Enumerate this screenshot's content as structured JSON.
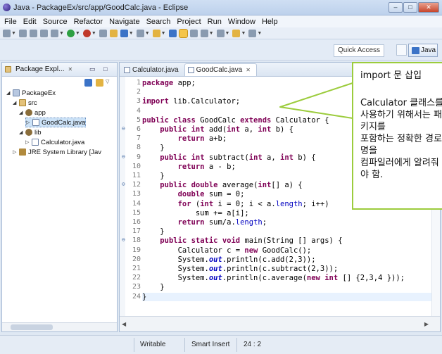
{
  "window": {
    "title": "Java - PackageEx/src/app/GoodCalc.java - Eclipse",
    "minimize_label": "–",
    "maximize_label": "□",
    "close_label": "✕"
  },
  "menu": [
    "File",
    "Edit",
    "Source",
    "Refactor",
    "Navigate",
    "Search",
    "Project",
    "Run",
    "Window",
    "Help"
  ],
  "quick_access": {
    "placeholder": "Quick Access"
  },
  "perspective": {
    "label": "Java"
  },
  "package_explorer": {
    "tab_label": "Package Expl...",
    "tree": [
      {
        "label": "PackageEx",
        "level": 0,
        "icon": "project-icon",
        "twisty": "◢"
      },
      {
        "label": "src",
        "level": 1,
        "icon": "source-folder-icon",
        "twisty": "◢"
      },
      {
        "label": "app",
        "level": 2,
        "icon": "package-icon",
        "twisty": "◢"
      },
      {
        "label": "GoodCalc.java",
        "level": 3,
        "icon": "java-file-icon",
        "twisty": "▷",
        "selected": true
      },
      {
        "label": "lib",
        "level": 2,
        "icon": "package-icon",
        "twisty": "◢"
      },
      {
        "label": "Calculator.java",
        "level": 3,
        "icon": "java-file-icon",
        "twisty": "▷"
      },
      {
        "label": "JRE System Library [Jav",
        "level": 1,
        "icon": "library-icon",
        "twisty": "▷"
      }
    ]
  },
  "editor": {
    "tabs": [
      {
        "label": "Calculator.java",
        "active": false
      },
      {
        "label": "GoodCalc.java",
        "active": true
      }
    ],
    "current_line": 24,
    "lines": [
      {
        "n": "1",
        "code": "package app;"
      },
      {
        "n": "2",
        "code": ""
      },
      {
        "n": "3",
        "code": "import lib.Calculator;"
      },
      {
        "n": "4",
        "code": ""
      },
      {
        "n": "5",
        "code": "public class GoodCalc extends Calculator {"
      },
      {
        "n": "6",
        "code": "    public int add(int a, int b) {",
        "fold": true
      },
      {
        "n": "7",
        "code": "        return a+b;"
      },
      {
        "n": "8",
        "code": "    }"
      },
      {
        "n": "9",
        "code": "    public int subtract(int a, int b) {",
        "fold": true
      },
      {
        "n": "10",
        "code": "        return a - b;"
      },
      {
        "n": "11",
        "code": "    }"
      },
      {
        "n": "12",
        "code": "    public double average(int[] a) {",
        "fold": true
      },
      {
        "n": "13",
        "code": "        double sum = 0;"
      },
      {
        "n": "14",
        "code": "        for (int i = 0; i < a.length; i++)"
      },
      {
        "n": "15",
        "code": "            sum += a[i];"
      },
      {
        "n": "16",
        "code": "        return sum/a.length;"
      },
      {
        "n": "17",
        "code": "    }"
      },
      {
        "n": "18",
        "code": "    public static void main(String [] args) {",
        "fold": true
      },
      {
        "n": "19",
        "code": "        Calculator c = new GoodCalc();"
      },
      {
        "n": "20",
        "code": "        System.out.println(c.add(2,3));"
      },
      {
        "n": "21",
        "code": "        System.out.println(c.subtract(2,3));"
      },
      {
        "n": "22",
        "code": "        System.out.println(c.average(new int [] {2,3,4 }));"
      },
      {
        "n": "23",
        "code": "    }"
      },
      {
        "n": "24",
        "code": "}"
      }
    ]
  },
  "status": {
    "mode": "Writable",
    "insert": "Smart Insert",
    "position": "24 : 2"
  },
  "callout": {
    "lines": [
      "import 문 삽입",
      "",
      "Calculator 클래스를",
      "사용하기 위해서는 패",
      "키지를",
      "포함하는 정확한 경로",
      "명을",
      "컴파일러에게 알려줘",
      "야 함."
    ],
    "border_color": "#9ccc3d"
  }
}
